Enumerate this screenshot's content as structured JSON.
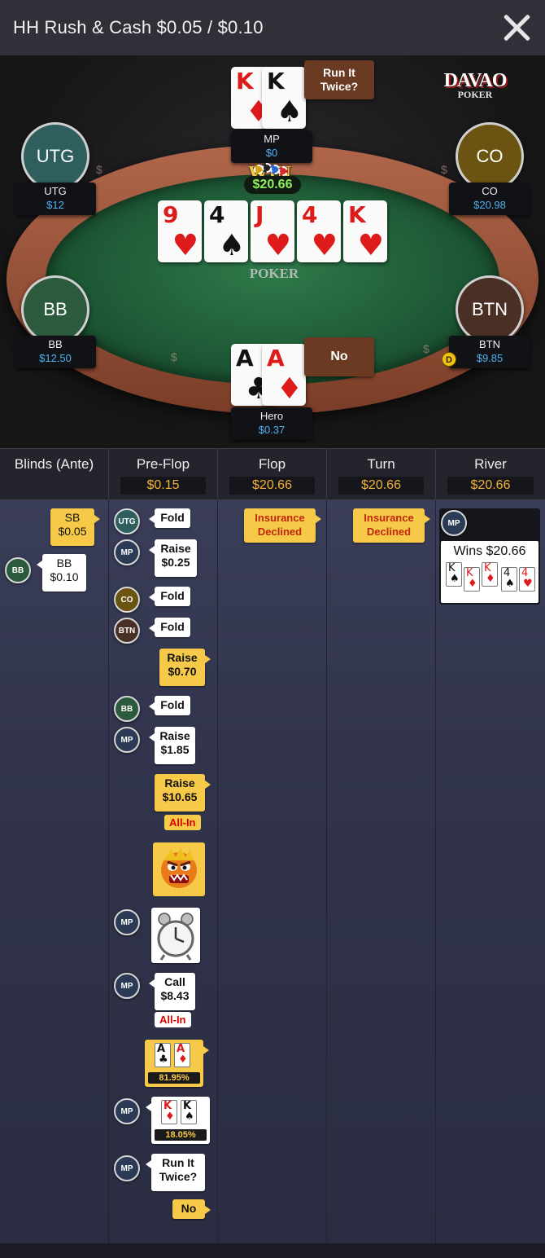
{
  "header": {
    "title": "HH  Rush & Cash $0.05 / $0.10"
  },
  "brand": {
    "name": "DAVAO",
    "sub": "POKER"
  },
  "felt_logo": "POKER",
  "players": {
    "utg": {
      "seat": "UTG",
      "name": "UTG",
      "stack": "$12"
    },
    "co": {
      "seat": "CO",
      "name": "CO",
      "stack": "$20.98"
    },
    "bb": {
      "seat": "BB",
      "name": "BB",
      "stack": "$12.50"
    },
    "btn": {
      "seat": "BTN",
      "name": "BTN",
      "stack": "$9.85"
    },
    "mp": {
      "name": "MP",
      "stack": "$0"
    },
    "hero": {
      "name": "Hero",
      "stack": "$0.37"
    }
  },
  "mp_cards": [
    {
      "rank": "K",
      "suit": "♦"
    },
    {
      "rank": "K",
      "suit": "♠"
    }
  ],
  "hero_cards": [
    {
      "rank": "A",
      "suit": "♣"
    },
    {
      "rank": "A",
      "suit": "♦"
    }
  ],
  "board": [
    {
      "rank": "9",
      "suit": "♥"
    },
    {
      "rank": "4",
      "suit": "♠"
    },
    {
      "rank": "J",
      "suit": "♥"
    },
    {
      "rank": "4",
      "suit": "♥"
    },
    {
      "rank": "K",
      "suit": "♥"
    }
  ],
  "win_label": "WIN",
  "run_it_twice_prompt": "Run It Twice?",
  "hero_reply": "No",
  "pot": "$20.66",
  "dealer_button": "D",
  "columns": [
    {
      "title": "Blinds (Ante)",
      "pot": ""
    },
    {
      "title": "Pre-Flop",
      "pot": "$0.15"
    },
    {
      "title": "Flop",
      "pot": "$20.66"
    },
    {
      "title": "Turn",
      "pot": "$20.66"
    },
    {
      "title": "River",
      "pot": "$20.66"
    }
  ],
  "blinds": {
    "sb": "SB\n$0.05",
    "bb_avatar": "BB",
    "bb": "BB\n$0.10"
  },
  "preflop": {
    "utg_av": "UTG",
    "utg_act": "Fold",
    "mp_av": "MP",
    "mp_act": "Raise\n$0.25",
    "co_av": "CO",
    "co_act": "Fold",
    "btn_av": "BTN",
    "btn_act": "Fold",
    "hero_raise1": "Raise\n$0.70",
    "bb_av": "BB",
    "bb_act": "Fold",
    "mp2_act": "Raise\n$1.85",
    "hero_raise2": "Raise\n$10.65",
    "hero_allin": "All-In",
    "mp_call": "Call\n$8.43",
    "mp_allin": "All-In",
    "hero_equity": "81.95%",
    "mp_equity": "18.05%",
    "mp_rit": "Run It\nTwice?",
    "hero_no": "No"
  },
  "flop": {
    "insurance": "Insurance\nDeclined"
  },
  "turn": {
    "insurance": "Insurance\nDeclined"
  },
  "river": {
    "mp_av": "MP",
    "wins": "Wins $20.66",
    "cards": [
      {
        "rank": "K",
        "suit": "♠"
      },
      {
        "rank": "K",
        "suit": "♦"
      },
      {
        "rank": "K",
        "suit": "♦"
      },
      {
        "rank": "4",
        "suit": "♠"
      },
      {
        "rank": "4",
        "suit": "♥"
      }
    ]
  }
}
